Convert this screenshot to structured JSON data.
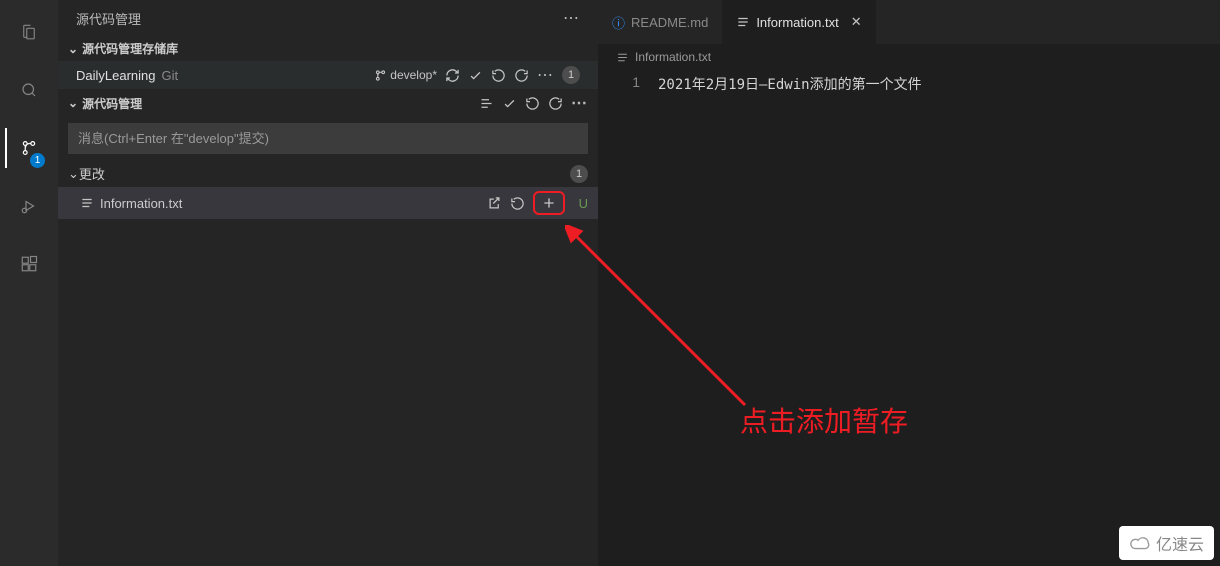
{
  "activityBar": {
    "badge": "1"
  },
  "sidebar": {
    "title": "源代码管理",
    "repoSection": "源代码管理存储库",
    "scmSection": "源代码管理",
    "repo": {
      "name": "DailyLearning",
      "type": "Git",
      "branch": "develop*",
      "count": "1"
    },
    "commitPlaceholder": "消息(Ctrl+Enter 在\"develop\"提交)",
    "changes": {
      "label": "更改",
      "count": "1"
    },
    "file": {
      "name": "Information.txt",
      "status": "U"
    }
  },
  "editor": {
    "tabs": [
      {
        "icon": "info",
        "label": "README.md",
        "active": false
      },
      {
        "icon": "lines",
        "label": "Information.txt",
        "active": true
      }
    ],
    "breadcrumb": "Information.txt",
    "lineNumber": "1",
    "lineContent": "2021年2月19日—Edwin添加的第一个文件"
  },
  "annotation": "点击添加暂存",
  "watermark": "亿速云"
}
